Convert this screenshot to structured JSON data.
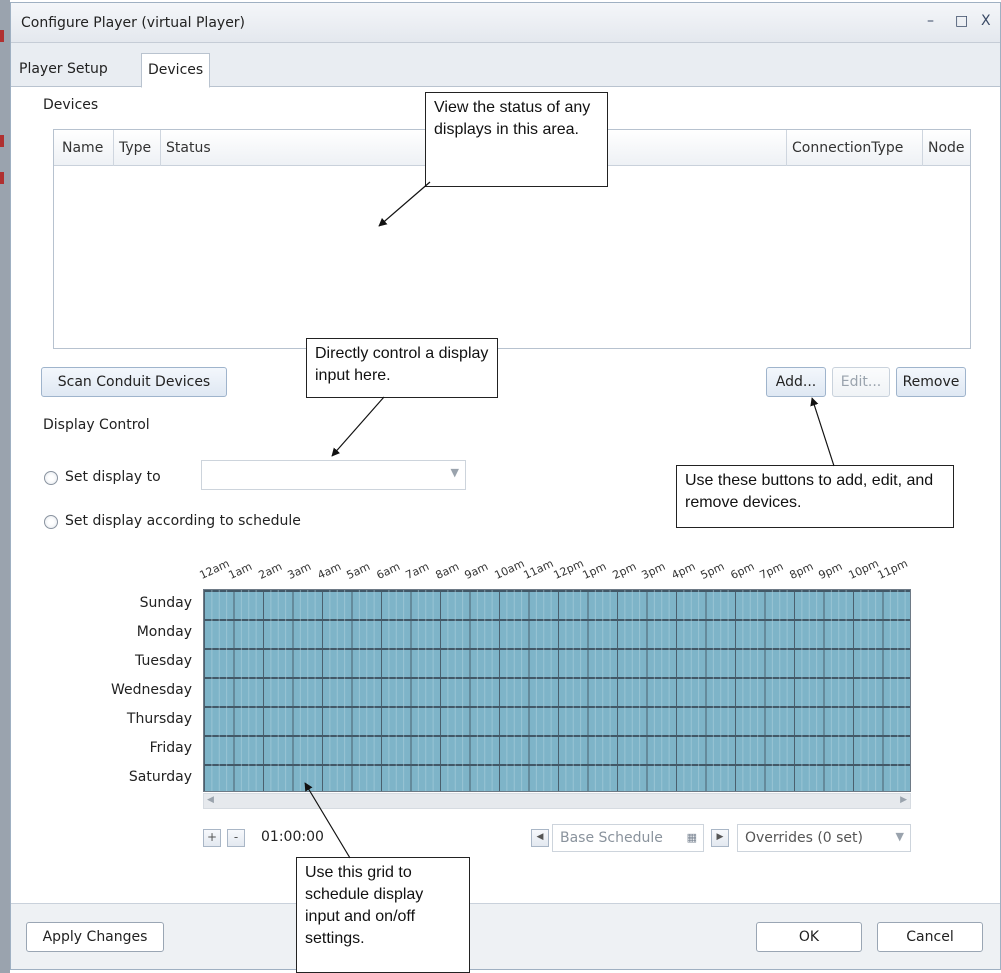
{
  "window": {
    "title": "Configure Player (virtual Player)",
    "controls": {
      "minimize": "–",
      "maximize": "□",
      "close": "X"
    }
  },
  "tabs": [
    {
      "label": "Player Setup",
      "active": false
    },
    {
      "label": "Devices",
      "active": true
    }
  ],
  "devices": {
    "section_label": "Devices",
    "columns": [
      "Name",
      "Type",
      "Status",
      "ConnectionType",
      "Node"
    ],
    "rows": []
  },
  "buttons": {
    "scan": "Scan Conduit Devices",
    "add": "Add...",
    "edit": "Edit...",
    "remove": "Remove",
    "apply": "Apply Changes",
    "ok": "OK",
    "cancel": "Cancel"
  },
  "display_control": {
    "label": "Display Control",
    "option_set_to": "Set display to",
    "option_schedule": "Set display according to schedule",
    "set_to_value": ""
  },
  "schedule": {
    "hours": [
      "12am",
      "1am",
      "2am",
      "3am",
      "4am",
      "5am",
      "6am",
      "7am",
      "8am",
      "9am",
      "10am",
      "11am",
      "12pm",
      "1pm",
      "2pm",
      "3pm",
      "4pm",
      "5pm",
      "6pm",
      "7pm",
      "8pm",
      "9pm",
      "10pm",
      "11pm"
    ],
    "days": [
      "Sunday",
      "Monday",
      "Tuesday",
      "Wednesday",
      "Thursday",
      "Friday",
      "Saturday"
    ],
    "zoom_in": "+",
    "zoom_out": "-",
    "interval": "01:00:00",
    "base_schedule": "Base Schedule",
    "overrides": "Overrides (0 set)"
  },
  "callouts": {
    "status": "View the status of any displays in this area.",
    "control": "Directly control a display input here.",
    "buttons": "Use these buttons to add, edit, and remove devices.",
    "grid": "Use this grid to schedule display input and on/off settings."
  },
  "colors": {
    "grid_fill": "#7eb4c8",
    "button_accent": "#dfe8f3",
    "title_bar": "#e4e8ee"
  }
}
